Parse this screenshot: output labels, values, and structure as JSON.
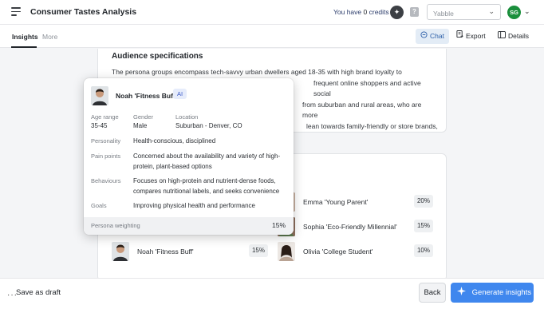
{
  "header": {
    "app_title": "Consumer Tastes Analysis",
    "credits_prefix": "You have",
    "credits_count": "0",
    "credits_suffix": "credits",
    "select_value": "Yabble",
    "user_initials": "SG"
  },
  "tabs": [
    {
      "label": "Insights",
      "active": true
    },
    {
      "label": "More",
      "active": false
    }
  ],
  "toolbar": {
    "chat_label": "Chat",
    "export_label": "Export",
    "details_label": "Details"
  },
  "audience": {
    "title": "Audience specifications",
    "lines": [
      "The persona groups encompass tech-savvy urban dwellers aged 18-35 with high brand loyalty to",
      "frequent online shoppers and active social",
      "from suburban and rural areas, who are more",
      "lean towards family-friendly or store brands,"
    ]
  },
  "personas": [
    {
      "name": "Emma 'Young Parent'",
      "weight": "20%"
    },
    {
      "name": "Sophia 'Eco-Friendly Millennial'",
      "weight": "15%"
    },
    {
      "name": "Noah 'Fitness Buff'",
      "weight": "15%"
    },
    {
      "name": "Olivia 'College Student'",
      "weight": "10%"
    }
  ],
  "popover": {
    "name": "Noah 'Fitness Buff'",
    "badge": "AI",
    "age_label": "Age range",
    "age_value": "35-45",
    "gender_label": "Gender",
    "gender_value": "Male",
    "location_label": "Location",
    "location_value": "Suburban - Denver, CO",
    "personality_label": "Personality",
    "personality_value": "Health-conscious, disciplined",
    "pain_label": "Pain points",
    "pain_line1": "Concerned about the availability and variety of high-",
    "pain_line2": "protein, plant-based options",
    "behaviours_label": "Behaviours",
    "behaviours_line1": "Focuses on high-protein and nutrient-dense foods,",
    "behaviours_line2": "compares nutritional labels, and seeks convenience",
    "goals_label": "Goals",
    "goals_value": "Improving physical health and performance",
    "weighting_label": "Persona weighting",
    "weighting_value": "15%"
  },
  "footer": {
    "save_draft_label": "Save as draft",
    "back_label": "Back",
    "generate_label": "Generate insights"
  },
  "colors": {
    "accent": "#3f87ee",
    "avatar": "#1a8f3c"
  }
}
